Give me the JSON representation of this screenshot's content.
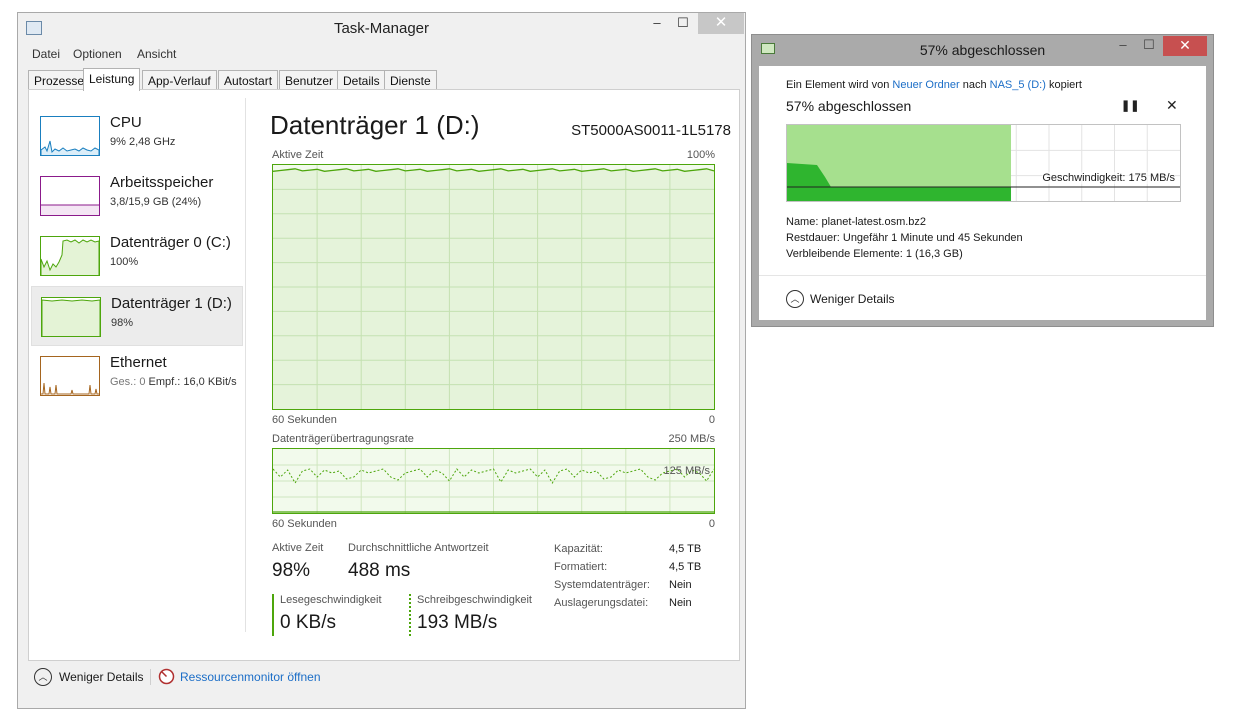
{
  "taskmanager": {
    "title": "Task-Manager",
    "menu": [
      "Datei",
      "Optionen",
      "Ansicht"
    ],
    "tabs": [
      "Prozesse",
      "Leistung",
      "App-Verlauf",
      "Autostart",
      "Benutzer",
      "Details",
      "Dienste"
    ],
    "active_tab": "Leistung",
    "sidebar": [
      {
        "name": "CPU",
        "sub": "9% 2,48 GHz",
        "color": "#1a7fbf"
      },
      {
        "name": "Arbeitsspeicher",
        "sub": "3,8/15,9 GB (24%)",
        "color": "#8b1a8b"
      },
      {
        "name": "Datenträger 0 (C:)",
        "sub": "100%",
        "color": "#4da60c"
      },
      {
        "name": "Datenträger 1 (D:)",
        "sub": "98%",
        "color": "#4da60c"
      },
      {
        "name": "Ethernet",
        "sub_prefix": "Ges.: 0",
        "sub_rest": "Empf.: 16,0 KBit/s",
        "color": "#a5651f"
      }
    ],
    "selected_index": 3,
    "panel": {
      "title": "Datenträger 1 (D:)",
      "model": "ST5000AS0011-1L5178",
      "graph1": {
        "label": "Aktive Zeit",
        "max": "100%",
        "time_label": "60 Sekunden",
        "min": "0",
        "level": 0.98
      },
      "graph2": {
        "label": "Datenträgerübertragungsrate",
        "max": "250 MB/s",
        "mid": "125 MB/s",
        "time_label": "60 Sekunden",
        "min": "0"
      },
      "stats": {
        "active_time_label": "Aktive Zeit",
        "active_time_value": "98%",
        "response_label": "Durchschnittliche Antwortzeit",
        "response_value": "488 ms",
        "read_label": "Lesegeschwindigkeit",
        "read_value": "0 KB/s",
        "write_label": "Schreibgeschwindigkeit",
        "write_value": "193 MB/s"
      },
      "properties": [
        {
          "key": "Kapazität:",
          "value": "4,5 TB"
        },
        {
          "key": "Formatiert:",
          "value": "4,5 TB"
        },
        {
          "key": "Systemdatenträger:",
          "value": "Nein"
        },
        {
          "key": "Auslagerungsdatei:",
          "value": "Nein"
        }
      ]
    },
    "footer": {
      "fewer_details": "Weniger Details",
      "resource_monitor": "Ressourcenmonitor öffnen"
    }
  },
  "copy_dialog": {
    "title": "57% abgeschlossen",
    "line_prefix": "Ein Element wird von",
    "source": "Neuer Ordner",
    "line_mid": "nach",
    "destination": "NAS_5 (D:)",
    "line_suffix": "kopiert",
    "progress_text": "57% abgeschlossen",
    "progress": 0.57,
    "speed_label": "Geschwindigkeit: 175 MB/s",
    "name_label": "Name:",
    "name_value": "planet-latest.osm.bz2",
    "remaining_label": "Restdauer:",
    "remaining_value": "Ungefähr 1 Minute und 45 Sekunden",
    "items_label": "Verbleibende Elemente:",
    "items_value": "1 (16,3 GB)",
    "fewer_details": "Weniger Details"
  },
  "icons": {
    "pause": "pause-icon",
    "close": "close-icon",
    "chevron_up": "chevron-up-icon",
    "resource_monitor": "resource-monitor-icon"
  }
}
